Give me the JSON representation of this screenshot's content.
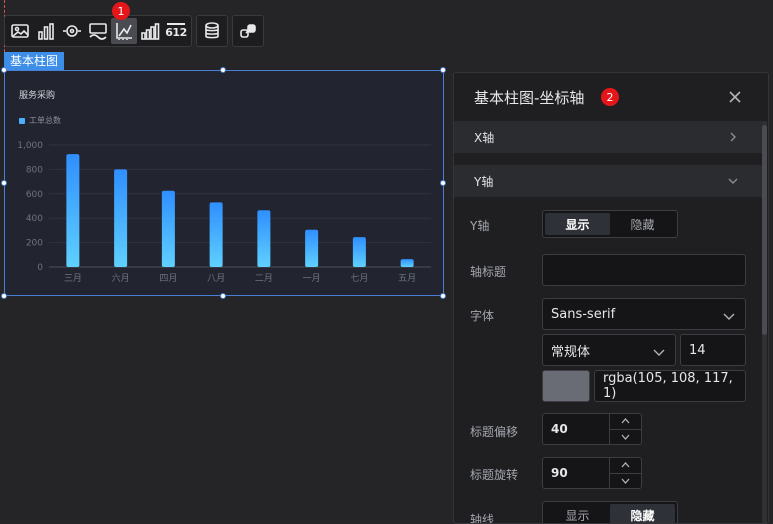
{
  "toolbar": {
    "badge_1": "1",
    "group1_icons": [
      "image-icon",
      "bar-chart-icon",
      "eye-icon",
      "map-icon",
      "axis-icon",
      "ranking-chart-icon",
      "number-icon"
    ],
    "number_icon_text": "612",
    "group2_icons": [
      "database-icon"
    ],
    "group3_icons": [
      "link-icon"
    ]
  },
  "component": {
    "label": "基本柱图",
    "chart_title": "服务采购",
    "legend": "工单总数"
  },
  "chart_data": {
    "type": "bar",
    "title": "服务采购",
    "legend": [
      "工单总数"
    ],
    "categories": [
      "三月",
      "六月",
      "四月",
      "八月",
      "二月",
      "一月",
      "七月",
      "五月"
    ],
    "series": [
      {
        "name": "工单总数",
        "values": [
          925,
          800,
          625,
          530,
          465,
          305,
          245,
          65
        ]
      }
    ],
    "yticks": [
      "0",
      "200",
      "400",
      "600",
      "800",
      "1,000"
    ],
    "ylim": [
      0,
      1000
    ],
    "grid": true,
    "legend_position": "top-left",
    "bar_color_top": "#2f8fff",
    "bar_color_bottom": "#5fd0ff"
  },
  "panel": {
    "title": "基本柱图-坐标轴",
    "badge_2": "2",
    "sections": {
      "x_axis": "X轴",
      "y_axis": "Y轴"
    },
    "y_axis_label": "Y轴",
    "show_label": "显示",
    "hide_label": "隐藏",
    "axis_title_label": "轴标题",
    "axis_title_value": "",
    "font_label": "字体",
    "font_family": "Sans-serif",
    "font_style": "常规体",
    "font_size": "14",
    "font_color": "rgba(105, 108, 117, 1)",
    "title_offset_label": "标题偏移",
    "title_offset_value": "40",
    "title_rotate_label": "标题旋转",
    "title_rotate_value": "90",
    "axis_line_label": "轴线",
    "axis_line_show": "显示",
    "axis_line_hide": "隐藏"
  }
}
